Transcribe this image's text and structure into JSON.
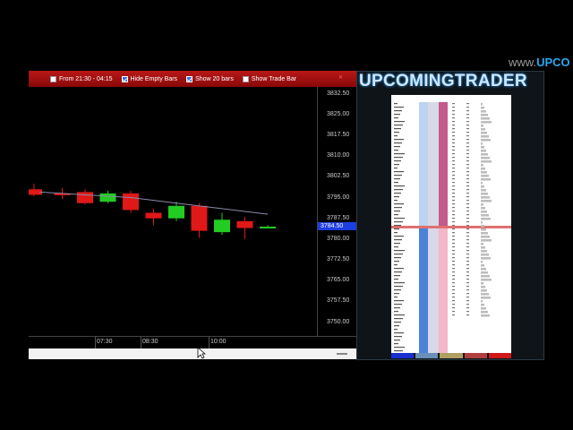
{
  "watermark": {
    "prefix": "www.",
    "brand": "UPCO"
  },
  "toolbar": {
    "from_label": "From  21:30 - 04:15",
    "from_checked": false,
    "hide_empty_label": "Hide Empty Bars",
    "hide_empty_checked": true,
    "show_bars_label": "Show  20 bars",
    "show_bars_checked": true,
    "show_trade_bar_label": "Show Trade Bar",
    "show_trade_bar_checked": false
  },
  "price_axis": {
    "labels": [
      "3832.50",
      "3825.00",
      "3817.50",
      "3810.00",
      "3802.50",
      "3795.00",
      "3787.50",
      "3780.00",
      "3772.50",
      "3765.00",
      "3757.50",
      "3750.00"
    ],
    "last_price": "3784.50"
  },
  "time_axis": {
    "labels": [
      "07:30",
      "08:30",
      "10:00"
    ]
  },
  "chart_data": {
    "type": "candlestick",
    "ylim": [
      3745,
      3835
    ],
    "last_price": 3784.5,
    "candles": [
      {
        "o": 3798.0,
        "h": 3800.0,
        "l": 3795.5,
        "c": 3796.0,
        "dir": "down"
      },
      {
        "o": 3796.5,
        "h": 3798.5,
        "l": 3794.5,
        "c": 3796.0,
        "dir": "down"
      },
      {
        "o": 3797.0,
        "h": 3798.0,
        "l": 3792.5,
        "c": 3793.0,
        "dir": "down"
      },
      {
        "o": 3793.5,
        "h": 3797.5,
        "l": 3793.0,
        "c": 3796.5,
        "dir": "up"
      },
      {
        "o": 3796.5,
        "h": 3797.5,
        "l": 3789.5,
        "c": 3790.5,
        "dir": "down"
      },
      {
        "o": 3789.5,
        "h": 3791.0,
        "l": 3785.0,
        "c": 3787.5,
        "dir": "down"
      },
      {
        "o": 3787.5,
        "h": 3793.5,
        "l": 3786.5,
        "c": 3792.0,
        "dir": "up"
      },
      {
        "o": 3792.0,
        "h": 3793.0,
        "l": 3780.5,
        "c": 3783.0,
        "dir": "down"
      },
      {
        "o": 3782.5,
        "h": 3789.5,
        "l": 3781.5,
        "c": 3787.0,
        "dir": "up"
      },
      {
        "o": 3786.5,
        "h": 3788.0,
        "l": 3780.0,
        "c": 3784.0,
        "dir": "down"
      },
      {
        "o": 3784.5,
        "h": 3785.0,
        "l": 3784.0,
        "c": 3784.5,
        "dir": "up"
      }
    ],
    "moving_average": [
      3797.0,
      3796.5,
      3796.0,
      3795.5,
      3795.0,
      3794.0,
      3793.0,
      3792.0,
      3791.0,
      3790.0,
      3789.0
    ],
    "colors": {
      "up": "#22cc22",
      "down": "#e01818",
      "ma": "#8a8aa8"
    }
  },
  "dom": {
    "brand": "UPCOMINGTRADER",
    "buttons": [
      {
        "color": "#1a2fd0"
      },
      {
        "color": "#6a8fb8"
      },
      {
        "color": "#b0a060"
      },
      {
        "color": "#b04040"
      },
      {
        "color": "#d01818"
      }
    ]
  }
}
